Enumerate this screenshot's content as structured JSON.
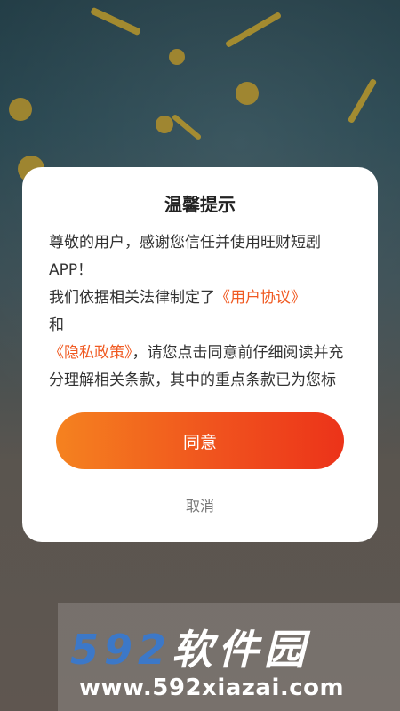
{
  "dialog": {
    "title": "温馨提示",
    "para1": "尊敬的用户，感谢您信任并使用旺财短剧APP！",
    "para2_prefix": "我们依据相关法律制定了",
    "user_agreement_link": "《用户协议》",
    "para2_and": "和",
    "privacy_policy_link": "《隐私政策》",
    "para2_suffix": "，请您点击同意前仔细阅读并充分理解相关条款，其中的重点条款已为您标记，方便您了解自己的权利。",
    "agree_button": "同意",
    "cancel_button": "取消"
  },
  "watermark": {
    "logo_number": "592",
    "logo_text": "软件园",
    "url": "www.592xiazai.com"
  },
  "colors": {
    "accent_start": "#f5821f",
    "accent_end": "#ec3319",
    "link": "#f05a22"
  }
}
